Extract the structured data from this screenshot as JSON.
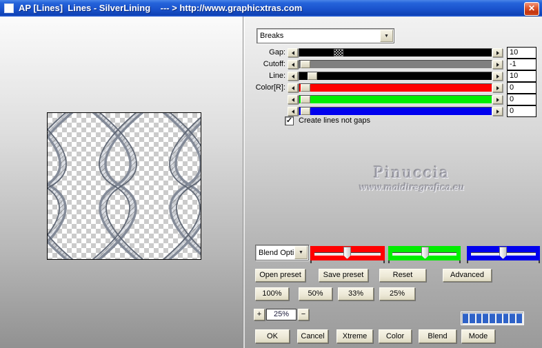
{
  "window": {
    "title": "AP [Lines]  Lines - SilverLining    --- > http://www.graphicxtras.com"
  },
  "icons": {
    "close_icon": "✕",
    "check_icon": "✓",
    "dropdown_arrow_icon": "▼"
  },
  "preset_combo": {
    "value": "Breaks"
  },
  "sliders": {
    "rows": [
      {
        "id": "gap",
        "label": "Gap:",
        "value": "10",
        "track_color": "#000000",
        "thumb": "dither"
      },
      {
        "id": "cutoff",
        "label": "Cutoff:",
        "value": "-1",
        "track_color": "#808080",
        "thumb": "solid"
      },
      {
        "id": "line",
        "label": "Line:",
        "value": "10",
        "track_color": "#000000",
        "thumb": "solid"
      },
      {
        "id": "red",
        "label": "Color[R]:",
        "value": "0",
        "track_color": "#ff0000",
        "thumb": "solid"
      },
      {
        "id": "green",
        "label": "",
        "value": "0",
        "track_color": "#00ff00",
        "thumb": "solid"
      },
      {
        "id": "blue",
        "label": "",
        "value": "0",
        "track_color": "#0000ff",
        "thumb": "solid"
      }
    ]
  },
  "options": {
    "create_lines_label": "Create lines not gaps",
    "checked": true
  },
  "watermark": {
    "name": "Pinuccia",
    "url": "www.maidiregrafica.eu"
  },
  "blend": {
    "combo_value": "Blend Opti",
    "channel_colors": [
      "#ff0000",
      "#00ff00",
      "#0000ff"
    ]
  },
  "preset_buttons": {
    "open": "Open preset",
    "save": "Save preset",
    "reset": "Reset",
    "advanced": "Advanced"
  },
  "zoom_presets": {
    "z100": "100%",
    "z50": "50%",
    "z33": "33%",
    "z25": "25%"
  },
  "zoom_control": {
    "plus": "+",
    "value": "25%",
    "minus": "−"
  },
  "progress": {
    "segments": 9,
    "segment_color": "#2e62c8"
  },
  "action_buttons": {
    "ok": "OK",
    "cancel": "Cancel",
    "xtreme": "Xtreme",
    "color": "Color",
    "blend": "Blend",
    "mode": "Mode"
  }
}
